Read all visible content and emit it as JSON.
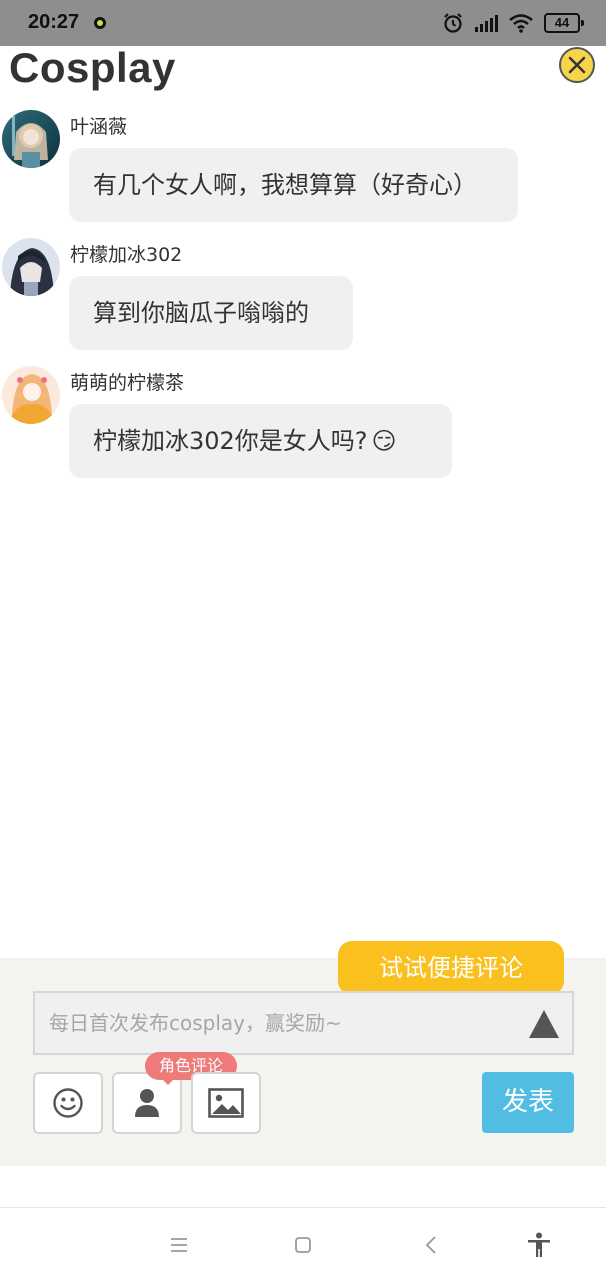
{
  "status_bar": {
    "time": "20:27",
    "battery": "44"
  },
  "header": {
    "title": "Cosplay"
  },
  "comments": [
    {
      "username": "叶涵薇",
      "text": "有几个女人啊，我想算算（好奇心）"
    },
    {
      "username": "柠檬加冰302",
      "text": "算到你脑瓜子嗡嗡的"
    },
    {
      "username": "萌萌的柠檬茶",
      "text": "柠檬加冰302你是女人吗?",
      "emoji": "😏"
    }
  ],
  "compose": {
    "hint": "试试便捷评论",
    "placeholder": "每日首次发布cosplay，赢奖励~",
    "role_tag": "角色评论",
    "publish_label": "发表"
  },
  "icons": {
    "emoji": "smiley-icon",
    "role": "person-icon",
    "image": "image-icon",
    "send": "triangle-up-icon",
    "close": "close-icon"
  },
  "colors": {
    "accent_yellow": "#f9c01e",
    "publish_blue": "#52bde2",
    "role_tag_red": "#ef7a7a",
    "bubble_gray": "#f0f0f0",
    "panel_bg": "#f4f3ef"
  }
}
